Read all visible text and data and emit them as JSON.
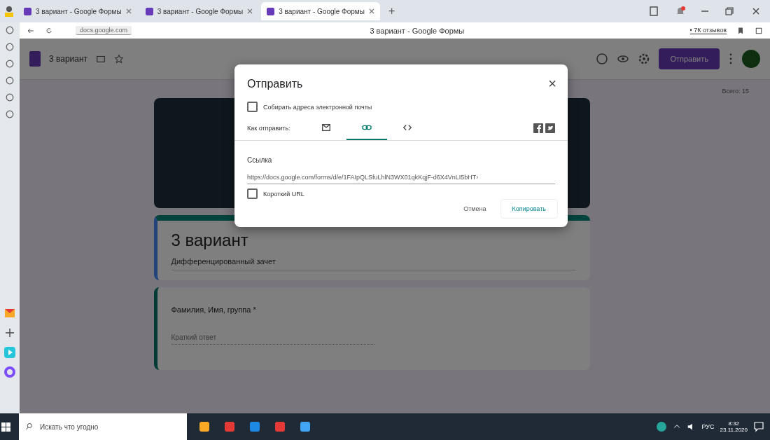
{
  "browser": {
    "tabs": [
      {
        "title": "3 вариант - Google Формы",
        "selected": false
      },
      {
        "title": "3 вариант - Google Формы",
        "selected": false
      },
      {
        "title": "3 вариант - Google Формы",
        "selected": true
      }
    ],
    "new_tab": "+",
    "address": "docs.google.com",
    "page_title": "3 вариант - Google Формы",
    "reviews": "• 7К отзывов"
  },
  "form_header": {
    "title": "3 вариант",
    "send_button": "Отправить",
    "points": "Всего: 15"
  },
  "form": {
    "title": "3 вариант",
    "description": "Дифференцированный зачет",
    "questions": [
      {
        "label": "Фамилия, Имя, группа *",
        "placeholder": "Краткий ответ"
      }
    ]
  },
  "dialog": {
    "title": "Отправить",
    "close": "×",
    "collect_email": {
      "label": "Собирать адреса электронной почты",
      "checked": false
    },
    "send_via": "Как отправить:",
    "methods": [
      {
        "kind": "email",
        "selected": false
      },
      {
        "kind": "link",
        "selected": true
      },
      {
        "kind": "embed",
        "selected": false
      }
    ],
    "link_heading": "Ссылка",
    "url": "https://docs.google.com/forms/d/e/1FAIpQLSfuLhlN3WX01qkKqjF-d6X4VnLI5bHT›",
    "short_url": {
      "label": "Короткий URL",
      "checked": false
    },
    "cancel": "Отмена",
    "copy": "Копировать"
  },
  "taskbar": {
    "search_placeholder": "Искать что угодно",
    "language": "РУС",
    "time": "8:32",
    "date": "23.11.2020"
  }
}
